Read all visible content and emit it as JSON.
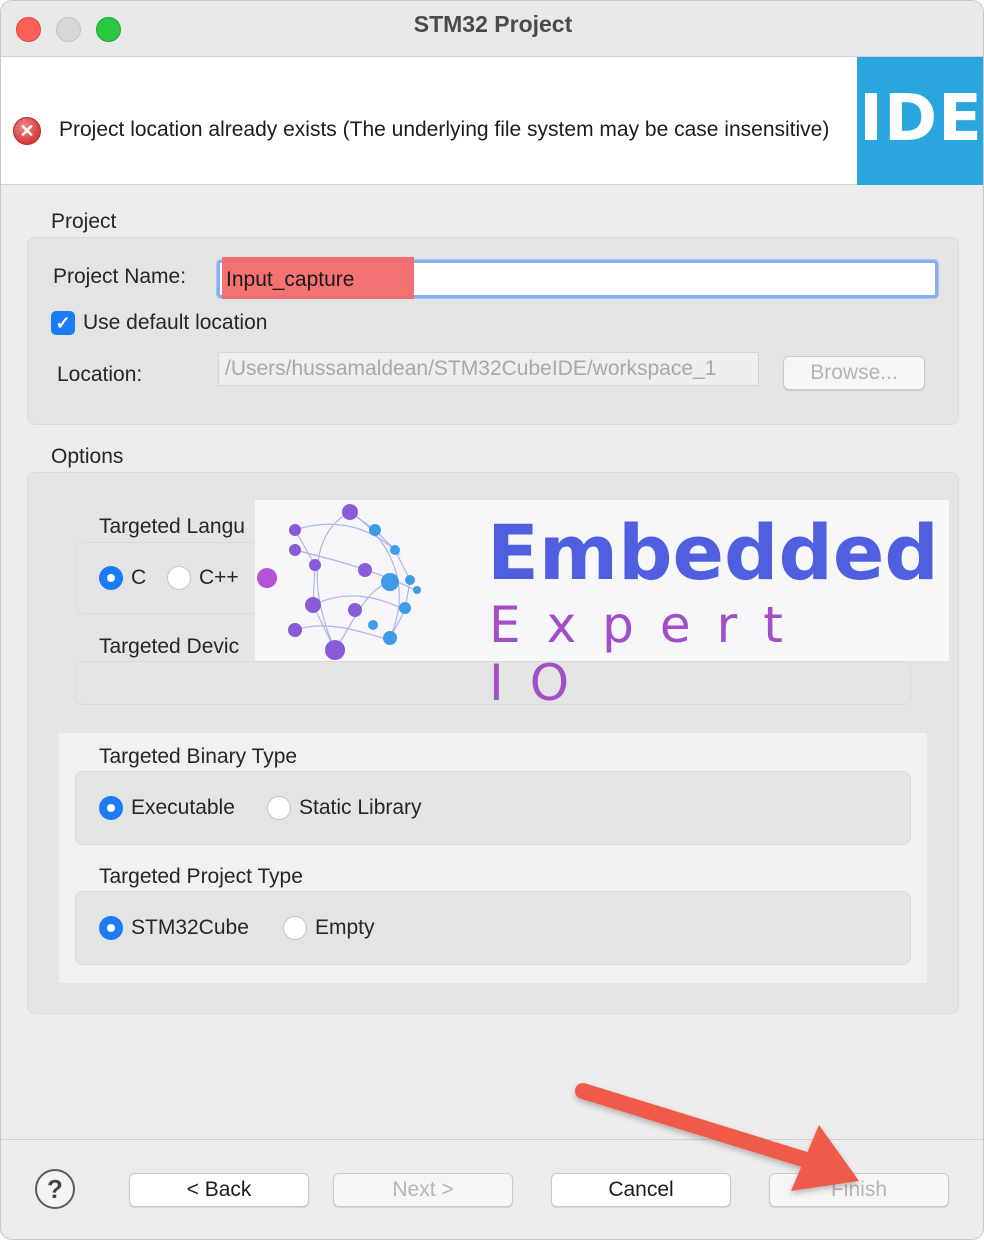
{
  "window": {
    "title": "STM32 Project"
  },
  "banner": {
    "error_message": "Project location already exists (The underlying file system may be case insensitive)",
    "logo_text": "IDE",
    "logo_color": "#2aa6df"
  },
  "project": {
    "section_title": "Project",
    "name_label": "Project Name:",
    "name_value": "Input_capture",
    "use_default_label": "Use default location",
    "use_default_checked": true,
    "location_label": "Location:",
    "location_value": "/Users/hussamaldean/STM32CubeIDE/workspace_1",
    "browse_label": "Browse..."
  },
  "options": {
    "section_title": "Options",
    "language": {
      "title": "Targeted Langu",
      "choices": [
        "C",
        "C++"
      ],
      "selected": "C"
    },
    "device": {
      "title": "Targeted Devic"
    },
    "binary": {
      "title": "Targeted Binary Type",
      "choices": [
        "Executable",
        "Static Library"
      ],
      "selected": "Executable"
    },
    "project_type": {
      "title": "Targeted Project Type",
      "choices": [
        "STM32Cube",
        "Empty"
      ],
      "selected": "STM32Cube"
    }
  },
  "overlay": {
    "line1": "Embedded",
    "line2": "Expert IO"
  },
  "footer": {
    "help": "?",
    "back": "< Back",
    "next": "Next >",
    "cancel": "Cancel",
    "finish": "Finish"
  },
  "colors": {
    "accent": "#1a7cf5",
    "arrow": "#ef5a4a",
    "error": "#d63a3a"
  }
}
